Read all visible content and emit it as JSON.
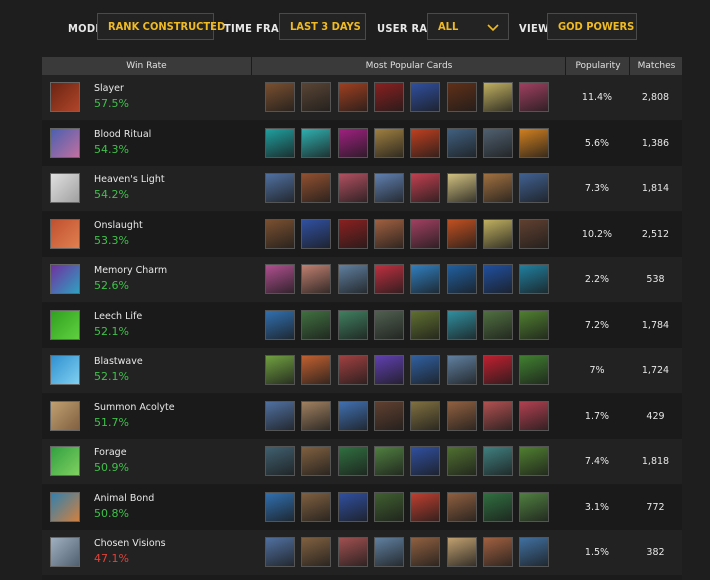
{
  "filters": {
    "mode": {
      "label": "MODE:",
      "value": "RANK CONSTRUCTED"
    },
    "time_frame": {
      "label": "TIME FRAME:",
      "value": "LAST 3 DAYS"
    },
    "user_rank": {
      "label": "USER RANK:",
      "value": "ALL"
    },
    "view": {
      "label": "VIEW:",
      "value": "GOD POWERS"
    }
  },
  "colors": {
    "accent": "#f0bb22",
    "good": "#3fc24a",
    "bad": "#e0433a"
  },
  "table": {
    "headers": {
      "win_rate": "Win Rate",
      "cards": "Most Popular Cards",
      "popularity": "Popularity",
      "matches": "Matches"
    },
    "rows": [
      {
        "name": "Slayer",
        "win_rate": "57.5%",
        "status": "good",
        "popularity": "11.4%",
        "matches": "2,808",
        "icon": [
          "#6b2412",
          "#b0452a"
        ],
        "cards": [
          "#7a5030",
          "#5a4535",
          "#a04020",
          "#8a2020",
          "#3050a0",
          "#603018",
          "#c0b060",
          "#a04060"
        ]
      },
      {
        "name": "Blood Ritual",
        "win_rate": "54.3%",
        "status": "good",
        "popularity": "5.6%",
        "matches": "1,386",
        "icon": [
          "#4860b0",
          "#c070a0"
        ],
        "cards": [
          "#20a0a0",
          "#30b0b0",
          "#a02080",
          "#a08040",
          "#c04020",
          "#406080",
          "#506070",
          "#d08020"
        ]
      },
      {
        "name": "Heaven's Light",
        "win_rate": "54.2%",
        "status": "good",
        "popularity": "7.3%",
        "matches": "1,814",
        "icon": [
          "#e0e0e0",
          "#a0a0a0"
        ],
        "cards": [
          "#5070a0",
          "#905030",
          "#b05060",
          "#6080b0",
          "#c04050",
          "#d0c080",
          "#a07040",
          "#406090"
        ]
      },
      {
        "name": "Onslaught",
        "win_rate": "53.3%",
        "status": "good",
        "popularity": "10.2%",
        "matches": "2,512",
        "icon": [
          "#c05030",
          "#e08050"
        ],
        "cards": [
          "#7a5030",
          "#3050a0",
          "#8a2020",
          "#a06040",
          "#a04060",
          "#c05020",
          "#c0b060",
          "#604030"
        ]
      },
      {
        "name": "Memory Charm",
        "win_rate": "52.6%",
        "status": "good",
        "popularity": "2.2%",
        "matches": "538",
        "icon": [
          "#7030a0",
          "#30a0c0"
        ],
        "cards": [
          "#b05090",
          "#c08070",
          "#6080a0",
          "#c03040",
          "#3080c0",
          "#2060a0",
          "#2050a0",
          "#2080a0"
        ]
      },
      {
        "name": "Leech Life",
        "win_rate": "52.1%",
        "status": "good",
        "popularity": "7.2%",
        "matches": "1,784",
        "icon": [
          "#30a020",
          "#60d040"
        ],
        "cards": [
          "#3070b0",
          "#407040",
          "#408060",
          "#506050",
          "#607030",
          "#3090a0",
          "#507040",
          "#508030"
        ]
      },
      {
        "name": "Blastwave",
        "win_rate": "52.1%",
        "status": "good",
        "popularity": "7%",
        "matches": "1,724",
        "icon": [
          "#3090d0",
          "#80d0f0"
        ],
        "cards": [
          "#70a040",
          "#c06030",
          "#a04040",
          "#6040b0",
          "#3060a0",
          "#6080a0",
          "#c02030",
          "#408030"
        ]
      },
      {
        "name": "Summon Acolyte",
        "win_rate": "51.7%",
        "status": "good",
        "popularity": "1.7%",
        "matches": "429",
        "icon": [
          "#c0a070",
          "#806040"
        ],
        "cards": [
          "#5070a0",
          "#a08060",
          "#4070b0",
          "#604030",
          "#807040",
          "#906040",
          "#b05050",
          "#b04050"
        ]
      },
      {
        "name": "Forage",
        "win_rate": "50.9%",
        "status": "good",
        "popularity": "7.4%",
        "matches": "1,818",
        "icon": [
          "#30a040",
          "#80d060"
        ],
        "cards": [
          "#406070",
          "#806040",
          "#307040",
          "#508040",
          "#3050a0",
          "#507030",
          "#408080",
          "#508030"
        ]
      },
      {
        "name": "Animal Bond",
        "win_rate": "50.8%",
        "status": "good",
        "popularity": "3.1%",
        "matches": "772",
        "icon": [
          "#3080b0",
          "#d08040"
        ],
        "cards": [
          "#3070b0",
          "#806040",
          "#3050a0",
          "#406030",
          "#c04030",
          "#906040",
          "#307040",
          "#508040"
        ]
      },
      {
        "name": "Chosen Visions",
        "win_rate": "47.1%",
        "status": "bad",
        "popularity": "1.5%",
        "matches": "382",
        "icon": [
          "#a0b0c0",
          "#506070"
        ],
        "cards": [
          "#5070a0",
          "#806040",
          "#a05050",
          "#6080a0",
          "#906040",
          "#c0a070",
          "#a06040",
          "#4070a0"
        ]
      }
    ]
  }
}
